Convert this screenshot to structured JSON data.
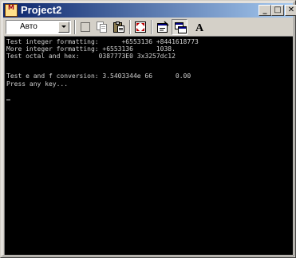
{
  "window": {
    "title": "Project2",
    "app_icon_text": "M"
  },
  "titlebar_buttons": {
    "minimize": "_",
    "maximize": "□",
    "close": "✕"
  },
  "toolbar": {
    "font_combo_value": "Авто",
    "tools": [
      "mark-icon",
      "copy-icon",
      "paste-icon",
      "fullscreen-icon",
      "properties-icon",
      "background-icon",
      "font-icon"
    ],
    "font_button_label": "A"
  },
  "console": {
    "lines": [
      "Test integer formatting:      +6553136 +8441618773",
      "More integer formatting: +6553136      1038.",
      "Test octal and hex:     0387773E0 3x3257dc12",
      "",
      "Test e and f conversion: 3.5403344e 66      0.00",
      "Press any key..."
    ],
    "background_color": "#000000",
    "text_color": "#d0d0d0"
  }
}
